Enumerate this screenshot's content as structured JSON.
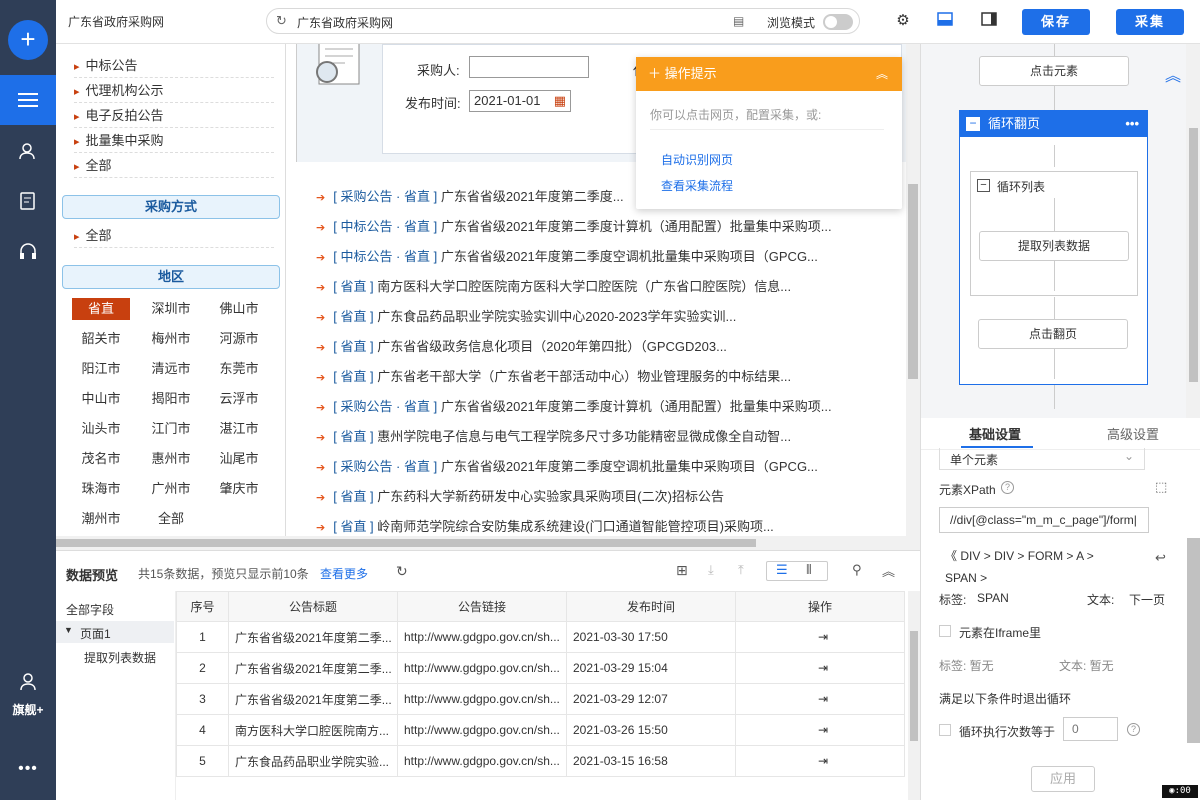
{
  "rail": {
    "flagship_label": "旗舰+"
  },
  "topbar": {
    "site_title": "广东省政府采购网",
    "address": "广东省政府采购网",
    "browse_mode_label": "浏览模式",
    "save_label": "保存",
    "collect_label": "采集"
  },
  "leftnav": {
    "links_top": [
      "中标公告",
      "代理机构公示",
      "电子反拍公告",
      "批量集中采购",
      "全部"
    ],
    "section_method": "采购方式",
    "method_links": [
      "全部"
    ],
    "section_region": "地区",
    "cities": [
      "省直",
      "深圳市",
      "佛山市",
      "韶关市",
      "梅州市",
      "河源市",
      "阳江市",
      "清远市",
      "东莞市",
      "中山市",
      "揭阳市",
      "云浮市",
      "汕头市",
      "江门市",
      "湛江市",
      "茂名市",
      "惠州市",
      "汕尾市",
      "珠海市",
      "广州市",
      "肇庆市",
      "潮州市",
      "全部"
    ]
  },
  "form": {
    "buyer_label": "采购人:",
    "date_label": "发布时间:",
    "date_value": "2021-01-01",
    "cut_label": "代"
  },
  "notices": [
    {
      "tag": "[ 采购公告 · 省直 ]",
      "title": "广东省省级2021年度第二季度..."
    },
    {
      "tag": "[ 中标公告 · 省直 ]",
      "title": "广东省省级2021年度第二季度计算机（通用配置）批量集中采购项..."
    },
    {
      "tag": "[ 中标公告 · 省直 ]",
      "title": "广东省省级2021年度第二季度空调机批量集中采购项目（GPCG..."
    },
    {
      "tag": "[ 省直 ]",
      "title": "南方医科大学口腔医院南方医科大学口腔医院（广东省口腔医院）信息..."
    },
    {
      "tag": "[ 省直 ]",
      "title": "广东食品药品职业学院实验实训中心2020-2023学年实验实训..."
    },
    {
      "tag": "[ 省直 ]",
      "title": "广东省省级政务信息化项目（2020年第四批）（GPCGD203..."
    },
    {
      "tag": "[ 省直 ]",
      "title": "广东省老干部大学（广东省老干部活动中心）物业管理服务的中标结果..."
    },
    {
      "tag": "[ 采购公告 · 省直 ]",
      "title": "广东省省级2021年度第二季度计算机（通用配置）批量集中采购项..."
    },
    {
      "tag": "[ 省直 ]",
      "title": "惠州学院电子信息与电气工程学院多尺寸多功能精密显微成像全自动智..."
    },
    {
      "tag": "[ 采购公告 · 省直 ]",
      "title": "广东省省级2021年度第二季度空调机批量集中采购项目（GPCG..."
    },
    {
      "tag": "[ 省直 ]",
      "title": "广东药科大学新药研发中心实验家具采购项目(二次)招标公告"
    },
    {
      "tag": "[ 省直 ]",
      "title": "岭南师范学院综合安防集成系统建设(门口通道智能管控项目)采购项..."
    }
  ],
  "popup": {
    "title": "操作提示",
    "desc": "你可以点击网页，配置采集，或:",
    "link1": "自动识别网页",
    "link2": "查看采集流程"
  },
  "preview": {
    "title": "数据预览",
    "info": "共15条数据，预览只显示前10条",
    "more": "查看更多",
    "tree_root": "全部字段",
    "tree_page": "页面1",
    "tree_leaf": "提取列表数据",
    "columns": [
      "序号",
      "公告标题",
      "公告链接",
      "发布时间",
      "操作"
    ],
    "rows": [
      [
        "1",
        "广东省省级2021年度第二季...",
        "http://www.gdgpo.gov.cn/sh...",
        "2021-03-30 17:50"
      ],
      [
        "2",
        "广东省省级2021年度第二季...",
        "http://www.gdgpo.gov.cn/sh...",
        "2021-03-29 15:04"
      ],
      [
        "3",
        "广东省省级2021年度第二季...",
        "http://www.gdgpo.gov.cn/sh...",
        "2021-03-29 12:07"
      ],
      [
        "4",
        "南方医科大学口腔医院南方...",
        "http://www.gdgpo.gov.cn/sh...",
        "2021-03-26 15:50"
      ],
      [
        "5",
        "广东食品药品职业学院实验...",
        "http://www.gdgpo.gov.cn/sh...",
        "2021-03-15 16:58"
      ]
    ]
  },
  "flow": {
    "click_element": "点击元素",
    "loop_page": "循环翻页",
    "loop_list": "循环列表",
    "extract_list": "提取列表数据",
    "click_page": "点击翻页"
  },
  "settings": {
    "tab_basic": "基础设置",
    "tab_adv": "高级设置",
    "select_value": "单个元素",
    "xpath_label": "元素XPath",
    "xpath_value": "//div[@class=\"m_m_c_page\"]/form|",
    "crumbs": [
      "DIV",
      "DIV",
      "FORM",
      "A",
      "SPAN"
    ],
    "tag_label": "标签:",
    "tag_value": "SPAN",
    "text_label": "文本:",
    "text_value": "下一页",
    "iframe_label": "元素在Iframe里",
    "tag_none": "标签: 暂无",
    "text_none": "文本: 暂无",
    "exit_label": "满足以下条件时退出循环",
    "loop_count_label": "循环执行次数等于",
    "loop_count_placeholder": "0",
    "apply_label": "应用"
  }
}
